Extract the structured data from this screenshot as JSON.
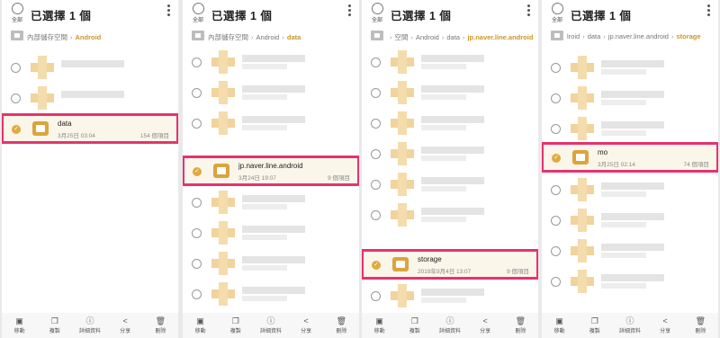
{
  "select_all_label": "全部",
  "title": "已選擇 1 個",
  "bottom_actions": [
    {
      "label": "移動",
      "icon": "move-icon"
    },
    {
      "label": "複製",
      "icon": "copy-icon"
    },
    {
      "label": "詳細資料",
      "icon": "info-icon"
    },
    {
      "label": "分享",
      "icon": "share-icon"
    },
    {
      "label": "刪除",
      "icon": "trash-icon"
    }
  ],
  "screens": [
    {
      "breadcrumb": [
        "內部儲存空間",
        "Android"
      ],
      "selected": {
        "name": "data",
        "date": "3月25日 03:04",
        "count": "154 個項目"
      }
    },
    {
      "breadcrumb": [
        "內部儲存空間",
        "Android",
        "data"
      ],
      "selected": {
        "name": "jp.naver.line.android",
        "date": "3月24日 19:07",
        "count": "9 個項目"
      }
    },
    {
      "breadcrumb": [
        "空間",
        "Android",
        "data",
        "jp.naver.line.android"
      ],
      "selected": {
        "name": "storage",
        "date": "2019年9月4日 13:07",
        "count": "9 個項目"
      }
    },
    {
      "breadcrumb": [
        "lroid",
        "data",
        "jp.naver.line.android",
        "storage"
      ],
      "selected": {
        "name": "mo",
        "date": "3月25日 02:14",
        "count": "74 個項目"
      }
    }
  ]
}
